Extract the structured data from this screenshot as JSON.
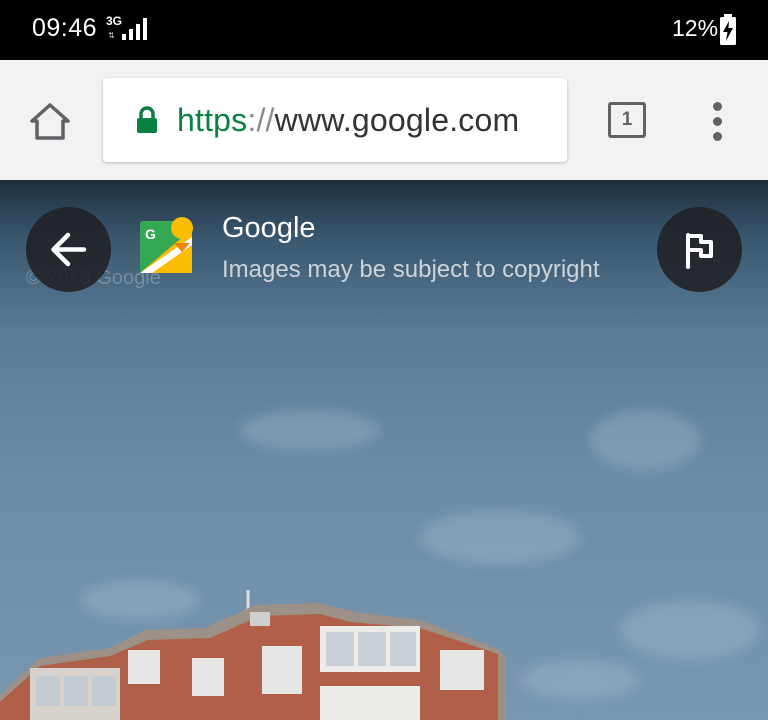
{
  "status_bar": {
    "time": "09:46",
    "network_type": "3G",
    "network_arrows": "⇅",
    "battery_percent": "12%",
    "icons": [
      "signal-icon",
      "battery-charging-icon"
    ]
  },
  "toolbar": {
    "url": {
      "scheme": "https",
      "separator": "://",
      "host": "www.google.com"
    },
    "tab_count": "1",
    "icons": [
      "home-icon",
      "lock-icon",
      "tab-switcher-icon",
      "more-vert-icon"
    ]
  },
  "viewer": {
    "source_title": "Google",
    "copyright_notice": "Images may be subject to copyright",
    "watermark": "© 2018 Google",
    "icons": [
      "back-arrow-icon",
      "google-street-view-icon",
      "flag-icon"
    ]
  },
  "colors": {
    "secure_green": "#0b8043",
    "toolbar_bg": "#f2f2f2",
    "overlay_button_bg": "#202124"
  }
}
